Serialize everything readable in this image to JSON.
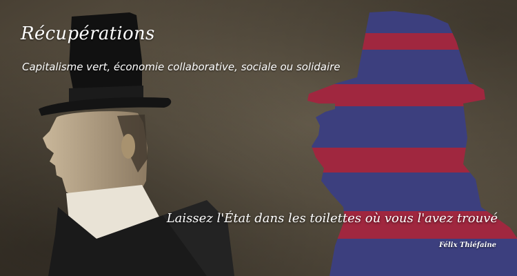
{
  "banner": {
    "title": "Récupérations",
    "subtitle": "Capitalisme vert, économie collaborative, sociale ou solidaire",
    "quote": "Laissez l'État dans les toilettes où vous l'avez trouvé",
    "author": "Félix Thiéfaine"
  },
  "image": {
    "left_figure": "man-in-top-hat-profile-photo",
    "right_figure": "striped-silhouette-in-top-hat",
    "colors": {
      "background": "#5a5142",
      "stripe_blue": "#3c3f7e",
      "stripe_red": "#a0273f",
      "text": "#ffffff"
    }
  }
}
